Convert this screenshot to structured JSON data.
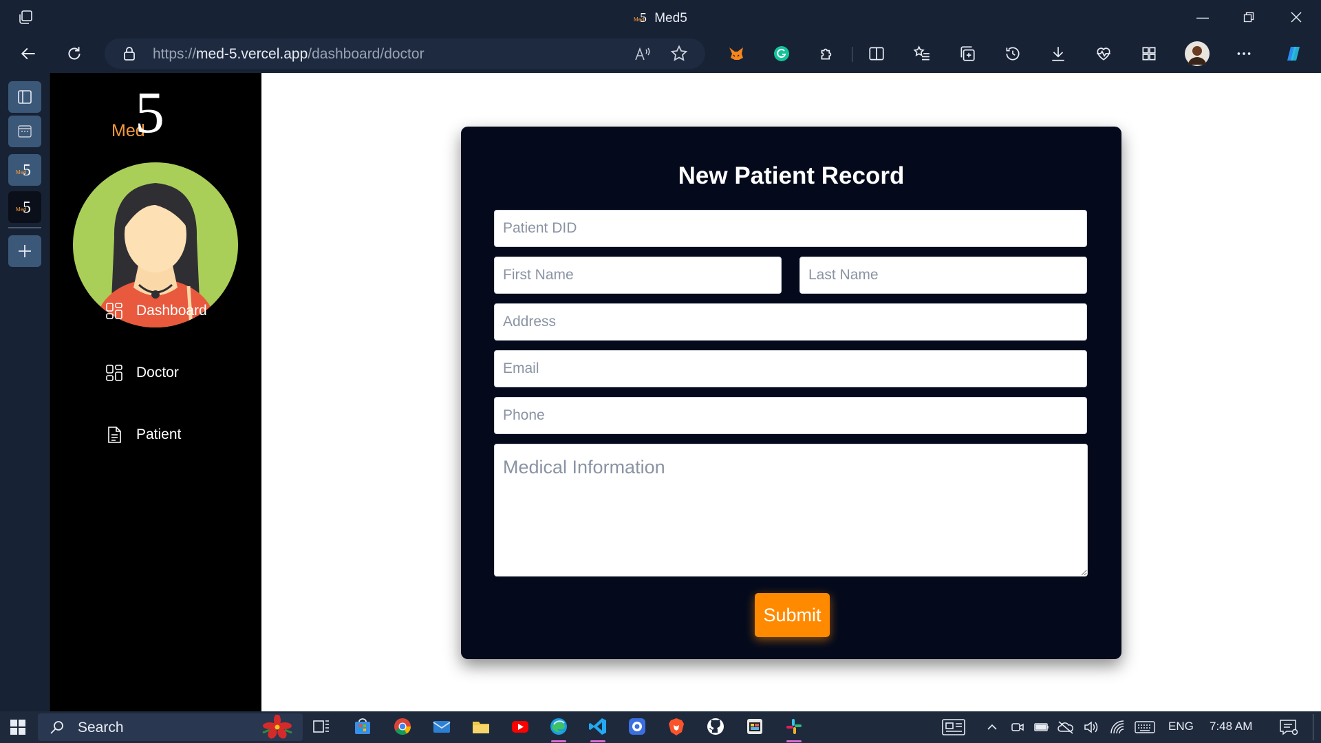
{
  "browser": {
    "window_title": "Med5",
    "url_scheme": "https://",
    "url_host": "med-5.vercel.app",
    "url_path": "/dashboard/doctor"
  },
  "sidebar": {
    "brand_text": "Med",
    "brand_numeral": "5",
    "nav": [
      {
        "label": "Dashboard",
        "icon": "dashboard-icon"
      },
      {
        "label": "Doctor",
        "icon": "dashboard-icon"
      },
      {
        "label": "Patient",
        "icon": "document-icon"
      }
    ]
  },
  "form": {
    "title": "New Patient Record",
    "patient_did_placeholder": "Patient DID",
    "first_name_placeholder": "First Name",
    "last_name_placeholder": "Last Name",
    "address_placeholder": "Address",
    "email_placeholder": "Email",
    "phone_placeholder": "Phone",
    "medical_info_placeholder": "Medical Information",
    "submit_label": "Submit"
  },
  "taskbar": {
    "search_label": "Search",
    "language": "ENG",
    "time": "7:48 AM"
  },
  "colors": {
    "accent": "#ff8a00",
    "card_bg": "#040a1c",
    "sidebar_bg": "#000000",
    "chrome_bg": "#172235"
  }
}
